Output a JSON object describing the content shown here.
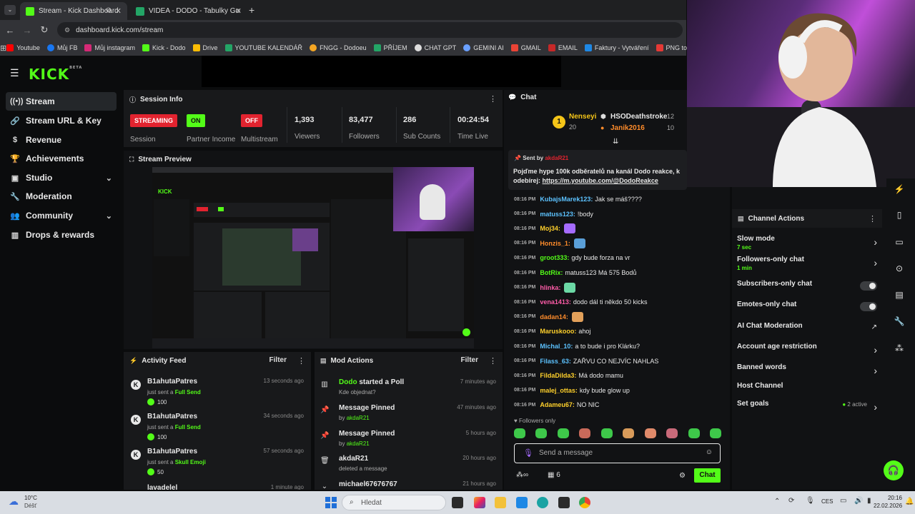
{
  "browser": {
    "tabs": [
      {
        "title": "Stream - Kick Dashboard",
        "active": true
      },
      {
        "title": "VIDEA - DODO - Tabulky Googl",
        "active": false
      }
    ],
    "url": "dashboard.kick.com/stream",
    "bookmarks": [
      "Youtube",
      "Můj FB",
      "Můj instagram",
      "Kick - Dodo",
      "Drive",
      "YOUTUBE KALENDÁŘ",
      "FNGG - Dodoeu",
      "PŘÍJEM",
      "CHAT GPT",
      "GEMINI AI",
      "GMAIL",
      "EMAIL",
      "Faktury - Vytváření",
      "PNG to PDF"
    ]
  },
  "brand": {
    "logo": "KICK",
    "beta": "BETA",
    "accent": "#53fc18"
  },
  "sidebar": {
    "items": [
      {
        "label": "Stream",
        "icon": "radio-icon"
      },
      {
        "label": "Stream URL & Key",
        "icon": "link-icon"
      },
      {
        "label": "Revenue",
        "icon": "dollar-icon"
      },
      {
        "label": "Achievements",
        "icon": "trophy-icon"
      },
      {
        "label": "Studio",
        "icon": "camera-icon"
      },
      {
        "label": "Moderation",
        "icon": "wrench-icon"
      },
      {
        "label": "Community",
        "icon": "users-icon"
      },
      {
        "label": "Drops & rewards",
        "icon": "gift-icon"
      }
    ]
  },
  "session": {
    "title": "Session Info",
    "stats": [
      {
        "badge": "STREAMING",
        "label": "Session"
      },
      {
        "badge": "ON",
        "label": "Partner Income"
      },
      {
        "badge": "OFF",
        "label": "Multistream"
      },
      {
        "value": "1,393",
        "label": "Viewers"
      },
      {
        "value": "83,477",
        "label": "Followers"
      },
      {
        "value": "286",
        "label": "Sub Counts"
      },
      {
        "value": "00:24:54",
        "label": "Time Live"
      }
    ]
  },
  "preview": {
    "title": "Stream Preview"
  },
  "activity": {
    "title": "Activity Feed",
    "filter": "Filter",
    "items": [
      {
        "name": "B1ahutaPatres",
        "pre": "just sent a",
        "gift": "Full Send",
        "amount": "100",
        "time": "13 seconds ago"
      },
      {
        "name": "B1ahutaPatres",
        "pre": "just sent a",
        "gift": "Full Send",
        "amount": "100",
        "time": "34 seconds ago"
      },
      {
        "name": "B1ahutaPatres",
        "pre": "just sent a",
        "gift": "Skull Emoji",
        "amount": "50",
        "time": "57 seconds ago"
      }
    ],
    "partial_name": "lavadelel",
    "partial_time": "1 minute ago"
  },
  "mod": {
    "title": "Mod Actions",
    "filter": "Filter",
    "items": [
      {
        "who": "Dodo",
        "action": "started a Poll",
        "sub": "Kde objednat?",
        "time": "7 minutes ago",
        "icon": "poll-icon"
      },
      {
        "action": "Message Pinned",
        "sub_pre": "by",
        "sub_who": "akdaR21",
        "time": "47 minutes ago",
        "icon": "pin-icon"
      },
      {
        "action": "Message Pinned",
        "sub_pre": "by",
        "sub_who": "akdaR21",
        "time": "5 hours ago",
        "icon": "pin-icon"
      },
      {
        "action": "akdaR21",
        "sub": "deleted a message",
        "time": "20 hours ago",
        "icon": "trash-icon"
      },
      {
        "action": "michael67676767",
        "sub": "",
        "time": "21 hours ago",
        "icon": "chevron-icon"
      }
    ]
  },
  "chat": {
    "title": "Chat",
    "leaderboard": [
      {
        "rank": "1",
        "name": "Nenseyi",
        "count": "20"
      },
      {
        "name": "HSODeathstroke",
        "count": "12"
      },
      {
        "name": "Janik2016",
        "count": "10"
      }
    ],
    "pinned": {
      "sent_by": "Sent by",
      "author": "akdaR21",
      "text": "Pojďme hype 100k odběratelů na kanál Dodo reakce, k odebírej:",
      "link": "https://m.youtube.com/@DodoReakce"
    },
    "messages": [
      {
        "time": "08:16 PM",
        "user": "KubajsMarek123:",
        "color": "#5cc2ff",
        "text": "Jak se máš????"
      },
      {
        "time": "08:16 PM",
        "user": "matuss123:",
        "color": "#5cc2ff",
        "text": "!body"
      },
      {
        "time": "08:16 PM",
        "user": "Moj34:",
        "color": "#ffd02b",
        "text": ""
      },
      {
        "time": "08:16 PM",
        "user": "Honzis_1:",
        "color": "#ff8c2b",
        "text": ""
      },
      {
        "time": "08:16 PM",
        "user": "groot333:",
        "color": "#53fc18",
        "text": "gdy bude forza na vr"
      },
      {
        "time": "08:16 PM",
        "user": "BotRix:",
        "color": "#53fc18",
        "text": "matuss123 Má 575 Bodů"
      },
      {
        "time": "08:16 PM",
        "user": "hlinka:",
        "color": "#ff5ca8",
        "text": ""
      },
      {
        "time": "08:16 PM",
        "user": "vena1413:",
        "color": "#ff5ca8",
        "text": "dodo dál ti někdo 50 kicks"
      },
      {
        "time": "08:16 PM",
        "user": "dadan14:",
        "color": "#ff8c2b",
        "text": ""
      },
      {
        "time": "08:16 PM",
        "user": "Maruskooo:",
        "color": "#ffd02b",
        "text": "ahoj"
      },
      {
        "time": "08:16 PM",
        "user": "Michal_10:",
        "color": "#5cc2ff",
        "text": "a to bude i pro Klárku?"
      },
      {
        "time": "08:16 PM",
        "user": "Filass_63:",
        "color": "#5cc2ff",
        "text": "ZAŘVU CO NEJVÍC NAHLAS"
      },
      {
        "time": "08:16 PM",
        "user": "FildaDilda3:",
        "color": "#ffd02b",
        "text": "Má dodo mamu"
      },
      {
        "time": "08:16 PM",
        "user": "malej_ottas:",
        "color": "#ffd02b",
        "text": "kdy bude glow up"
      },
      {
        "time": "08:16 PM",
        "user": "Adameu67:",
        "color": "#ffd02b",
        "text": "NO NIC"
      }
    ],
    "followers_only": "Followers only",
    "input_placeholder": "Send a message",
    "viewers_count": "6",
    "send_button": "Chat"
  },
  "channel_actions": {
    "title": "Channel Actions",
    "items": [
      {
        "label": "Slow mode",
        "sub": "7 sec",
        "control": "arrow"
      },
      {
        "label": "Followers-only chat",
        "sub": "1 min",
        "control": "arrow"
      },
      {
        "label": "Subscribers-only chat",
        "sub": "",
        "control": "toggle"
      },
      {
        "label": "Emotes-only chat",
        "sub": "",
        "control": "toggle"
      },
      {
        "label": "AI Chat Moderation",
        "sub": "",
        "control": "external"
      },
      {
        "label": "Account age restriction",
        "sub": "",
        "control": "arrow"
      },
      {
        "label": "Banned words",
        "sub": "",
        "control": "arrow"
      },
      {
        "label": "Host Channel",
        "sub": "",
        "control": "none"
      },
      {
        "label": "Set goals",
        "sub": "",
        "control": "arrow",
        "status": "2 active"
      }
    ]
  },
  "taskbar": {
    "weather_temp": "10°C",
    "weather_desc": "Déšť",
    "search": "Hledat",
    "lang": "CES",
    "time": "20:16",
    "date": "22.02.2026"
  }
}
